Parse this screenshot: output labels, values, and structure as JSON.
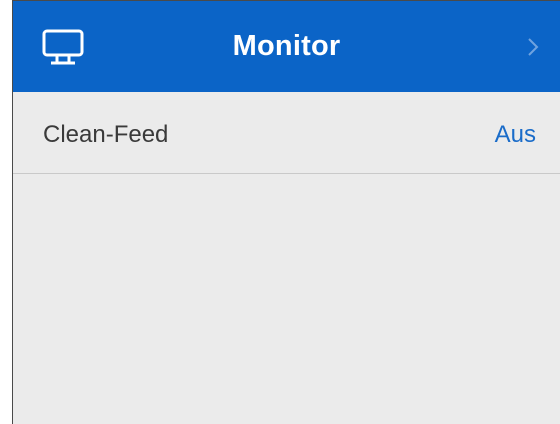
{
  "header": {
    "title": "Monitor",
    "icon": "monitor-icon",
    "chevron_icon": "chevron-right-icon"
  },
  "settings": [
    {
      "label": "Clean-Feed",
      "value": "Aus"
    }
  ],
  "colors": {
    "header_bg": "#0b64c7",
    "panel_bg": "#ebebeb",
    "value_text": "#1a6cc9",
    "label_text": "#3a3a3a"
  }
}
